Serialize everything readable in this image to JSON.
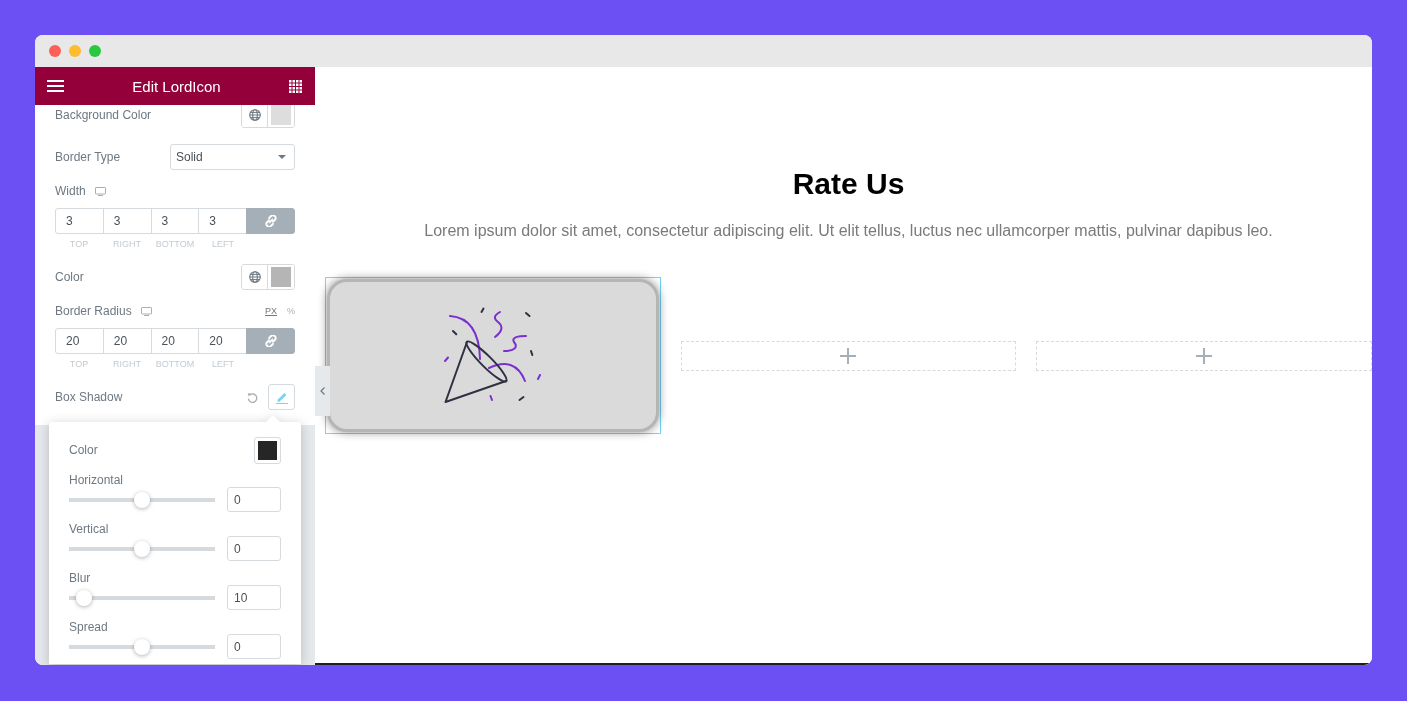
{
  "panel": {
    "title": "Edit LordIcon",
    "controls": [
      {
        "kind": "color",
        "label": "Background Color",
        "global": true,
        "color": "#dddddd"
      },
      {
        "kind": "select",
        "label": "Border Type",
        "value": "Solid"
      },
      {
        "kind": "dimensions",
        "label": "Width",
        "responsive": true,
        "fields": [
          {
            "value": "3",
            "label": "TOP"
          },
          {
            "value": "3",
            "label": "RIGHT"
          },
          {
            "value": "3",
            "label": "BOTTOM"
          },
          {
            "value": "3",
            "label": "LEFT"
          }
        ],
        "linked": true
      },
      {
        "kind": "color",
        "label": "Color",
        "global": true,
        "color": "#b5b5b5"
      },
      {
        "kind": "dimensions",
        "label": "Border Radius",
        "responsive": true,
        "units": [
          {
            "label": "PX",
            "selected": true
          },
          {
            "label": "%",
            "selected": false
          }
        ],
        "fields": [
          {
            "value": "20",
            "label": "TOP"
          },
          {
            "value": "20",
            "label": "RIGHT"
          },
          {
            "value": "20",
            "label": "BOTTOM"
          },
          {
            "value": "20",
            "label": "LEFT"
          }
        ],
        "linked": true
      },
      {
        "kind": "popover",
        "label": "Box Shadow",
        "open": true,
        "controls": [
          {
            "kind": "color",
            "label": "Color",
            "global": false,
            "color": "#262626"
          },
          {
            "kind": "slider",
            "label": "Horizontal",
            "level": 0.5,
            "value": "0"
          },
          {
            "kind": "slider",
            "label": "Vertical",
            "level": 0.5,
            "value": "0"
          },
          {
            "kind": "slider",
            "label": "Blur",
            "level": 0.1,
            "value": "10"
          },
          {
            "kind": "slider",
            "label": "Spread",
            "level": 0.5,
            "value": "0"
          }
        ]
      }
    ]
  },
  "canvas": {
    "heading": "Rate Us",
    "text": "Lorem ipsum dolor sit amet, consectetur adipiscing elit. Ut elit tellus, luctus nec ullamcorper mattis, pulvinar dapibus leo.",
    "columns": [
      {
        "kind": "icon",
        "selected": true
      },
      {
        "kind": "empty",
        "selected": false
      },
      {
        "kind": "empty",
        "selected": false
      }
    ]
  }
}
